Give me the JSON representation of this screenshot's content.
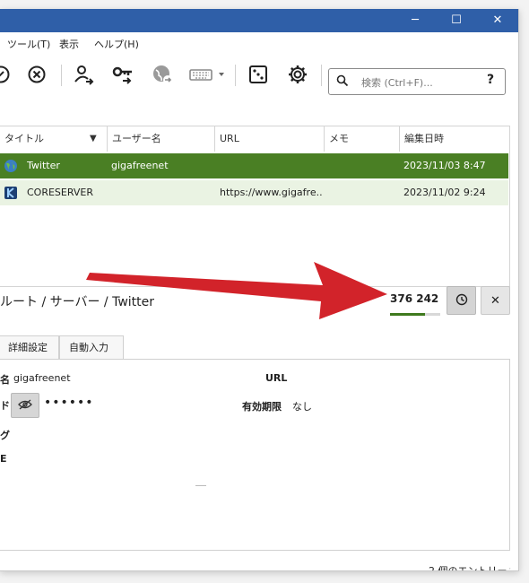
{
  "menu": {
    "tools": "ツール(T)",
    "view": "表示",
    "help": "ヘルプ(H)"
  },
  "search": {
    "placeholder": "検索 (Ctrl+F)...",
    "help": "?"
  },
  "columns": {
    "title": "タイトル",
    "username": "ユーザー名",
    "url": "URL",
    "notes": "メモ",
    "modified": "編集日時"
  },
  "entries": [
    {
      "title": "Twitter",
      "username": "gigafreenet",
      "url": "",
      "notes": "",
      "modified": "2023/11/03 8:47",
      "selected": true
    },
    {
      "title": "CORESERVER",
      "username": "",
      "url": "https://www.gigafre...",
      "notes": "",
      "modified": "2023/11/02 9:24",
      "selected": false
    }
  ],
  "detail": {
    "path": "ルート / サーバー / Twitter",
    "totp": "376 242",
    "totp_progress": 0.7,
    "tabs": [
      "詳細設定",
      "自動入力"
    ],
    "field_label_name": "名",
    "username": "gigafreenet",
    "field_label_password": "ド",
    "password": "••••••",
    "url_label": "URL",
    "expiry_label": "有効期限",
    "expiry_value": "なし",
    "tags_label": "グ",
    "notes_label": "E"
  },
  "status": {
    "entries_count": "2 個のエントリー"
  },
  "colors": {
    "selected_row": "#4a7f24",
    "alt_row": "#eaf3e3",
    "titlebar": "#2f5fa8",
    "arrow": "#d2232a"
  }
}
